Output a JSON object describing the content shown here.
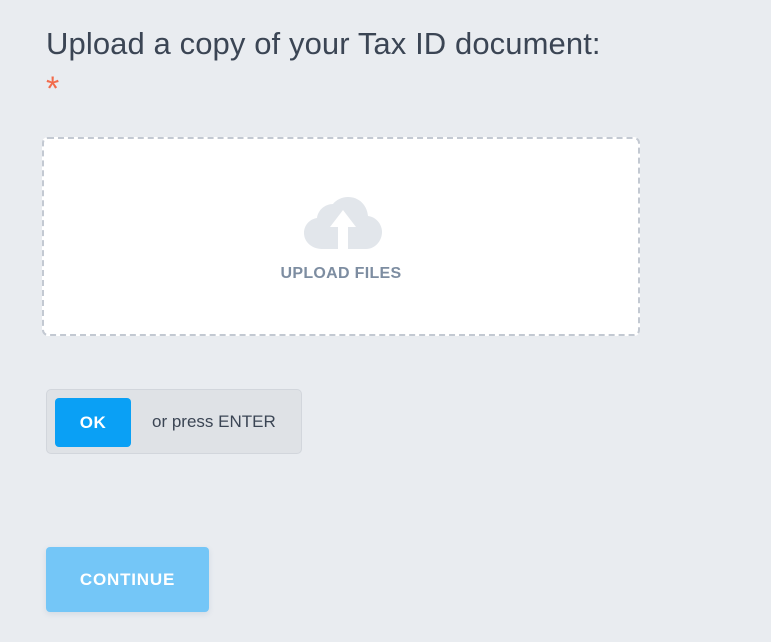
{
  "question": {
    "title": "Upload a copy of your Tax ID document:",
    "required_marker": "*"
  },
  "upload": {
    "label": "UPLOAD FILES",
    "icon": "cloud-upload-icon"
  },
  "confirm": {
    "ok_label": "OK",
    "hint": "or press ENTER"
  },
  "footer": {
    "continue_label": "CONTINUE"
  },
  "colors": {
    "background": "#e9ecf0",
    "accent": "#0aa0f5",
    "accent_disabled": "#74c6f7",
    "required": "#f26b4b",
    "text": "#3b4554"
  }
}
